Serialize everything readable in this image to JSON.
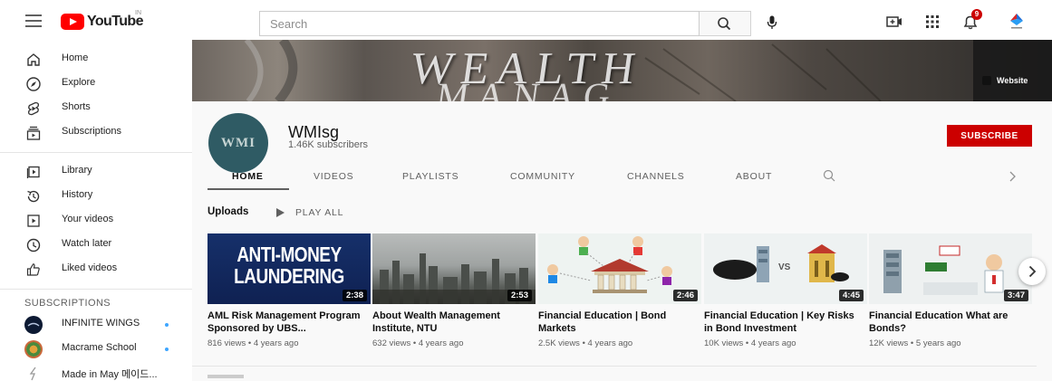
{
  "header": {
    "logo_text": "YouTube",
    "region": "IN",
    "search_placeholder": "Search",
    "notification_count": "9",
    "colors": {
      "brand": "#ff0000",
      "accent": "#cc0000"
    },
    "icons": [
      "menu-icon",
      "search-icon",
      "mic-icon",
      "create-icon",
      "apps-icon",
      "bell-icon",
      "account-icon"
    ]
  },
  "sidebar": {
    "main": [
      {
        "label": "Home",
        "icon": "home-icon"
      },
      {
        "label": "Explore",
        "icon": "compass-icon"
      },
      {
        "label": "Shorts",
        "icon": "shorts-icon"
      },
      {
        "label": "Subscriptions",
        "icon": "subscriptions-icon"
      }
    ],
    "library": [
      {
        "label": "Library",
        "icon": "library-icon"
      },
      {
        "label": "History",
        "icon": "history-icon"
      },
      {
        "label": "Your videos",
        "icon": "your-videos-icon"
      },
      {
        "label": "Watch later",
        "icon": "clock-icon"
      },
      {
        "label": "Liked videos",
        "icon": "thumbs-up-icon"
      }
    ],
    "subscriptions_heading": "SUBSCRIPTIONS",
    "subscriptions": [
      {
        "label": "INFINITE WINGS"
      },
      {
        "label": "Macrame School"
      },
      {
        "label": "Made in May 메이드..."
      }
    ]
  },
  "banner": {
    "text_line1": "WEALTH",
    "text_line2": "MANAG",
    "link_label": "Website"
  },
  "channel": {
    "name": "WMIsg",
    "avatar_text": "WMI",
    "subscribers": "1.46K subscribers",
    "subscribe_label": "SUBSCRIBE"
  },
  "tabs": [
    {
      "label": "HOME",
      "active": true
    },
    {
      "label": "VIDEOS"
    },
    {
      "label": "PLAYLISTS"
    },
    {
      "label": "COMMUNITY"
    },
    {
      "label": "CHANNELS"
    },
    {
      "label": "ABOUT"
    }
  ],
  "uploads": {
    "heading": "Uploads",
    "play_all": "PLAY ALL",
    "videos": [
      {
        "thumb_text_1": "ANTI-MONEY",
        "thumb_text_2": "LAUNDERING",
        "duration": "2:38",
        "title": "AML Risk Management Program Sponsored by UBS...",
        "meta": "816 views • 4 years ago"
      },
      {
        "duration": "2:53",
        "title": "About Wealth Management Institute, NTU",
        "meta": "632 views • 4 years ago"
      },
      {
        "duration": "2:46",
        "title": "Financial Education | Bond Markets",
        "meta": "2.5K views • 4 years ago"
      },
      {
        "thumb_text_vs": "VS",
        "duration": "4:45",
        "title": "Financial Education | Key Risks in Bond Investment",
        "meta": "10K views • 4 years ago"
      },
      {
        "duration": "3:47",
        "title": "Financial Education What are Bonds?",
        "meta": "12K views • 5 years ago"
      }
    ]
  }
}
